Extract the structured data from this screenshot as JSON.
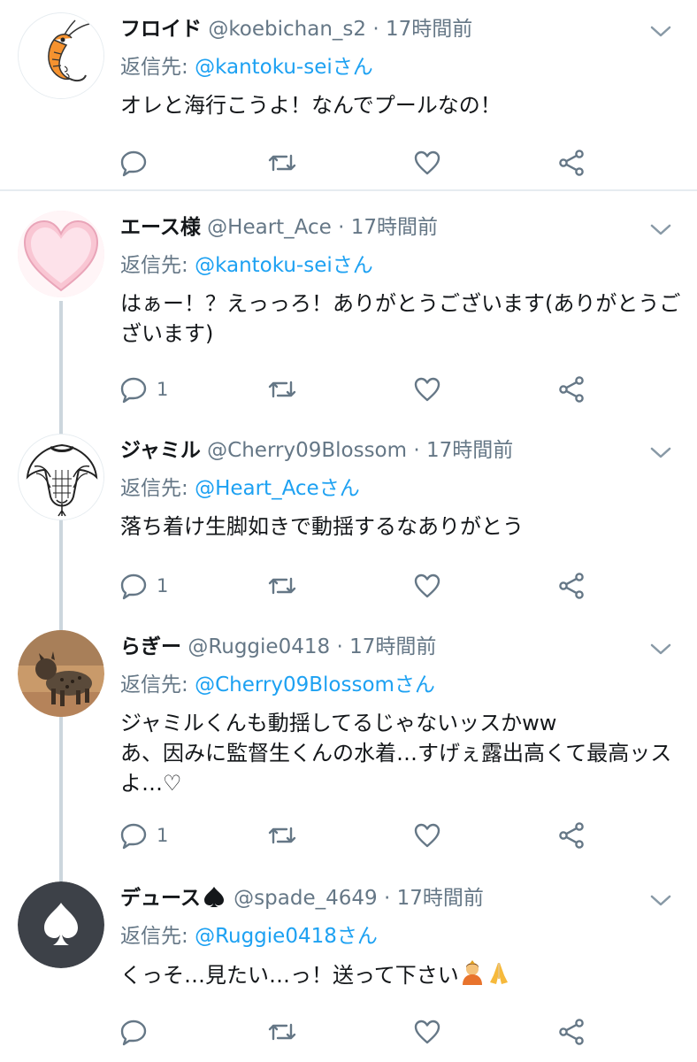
{
  "tweets": [
    {
      "name": "フロイド",
      "handle": "@koebichan_s2",
      "sep": "·",
      "time": "17時間前",
      "reply_prefix": "返信先: ",
      "reply_mention": "@kantoku-sei",
      "reply_suffix": "さん",
      "text": "オレと海行こうよ！なんでプールなの！",
      "reply_count": "",
      "avatar": "shrimp-avatar"
    },
    {
      "name": "エース様",
      "handle": "@Heart_Ace",
      "sep": "·",
      "time": "17時間前",
      "reply_prefix": "返信先: ",
      "reply_mention": "@kantoku-sei",
      "reply_suffix": "さん",
      "text": "はぁー！？えっっろ！ありがとうございます(ありがとうございます)",
      "reply_count": "1",
      "avatar": "heart-avatar"
    },
    {
      "name": "ジャミル",
      "handle": "@Cherry09Blossom",
      "sep": "·",
      "time": "17時間前",
      "reply_prefix": "返信先: ",
      "reply_mention": "@Heart_Ace",
      "reply_suffix": "さん",
      "text": "落ち着け生脚如きで動揺するなありがとう",
      "reply_count": "1",
      "avatar": "cobra-avatar"
    },
    {
      "name": "らぎー",
      "handle": "@Ruggie0418",
      "sep": "·",
      "time": "17時間前",
      "reply_prefix": "返信先: ",
      "reply_mention": "@Cherry09Blossom",
      "reply_suffix": "さん",
      "text": "ジャミルくんも動揺してるじゃないッスかww\nあ、因みに監督生くんの水着…すげぇ露出高くて最高ッスよ…♡",
      "reply_count": "1",
      "avatar": "hyena-avatar"
    },
    {
      "name": "デュース",
      "name_emoji": "spade-icon",
      "handle": "@spade_4649",
      "sep": "·",
      "time": "17時間前",
      "reply_prefix": "返信先: ",
      "reply_mention": "@Ruggie0418",
      "reply_suffix": "さん",
      "text": "くっそ…見たい…っ！送って下さい",
      "text_emoji": [
        "bowing-person-icon",
        "folded-hands-icon"
      ],
      "reply_count": "",
      "avatar": "spade-avatar"
    }
  ],
  "colors": {
    "link": "#1da1f2",
    "muted": "#657786",
    "text": "#14171a",
    "divider": "#e6ecf0",
    "thread_line": "#ccd6dd"
  }
}
